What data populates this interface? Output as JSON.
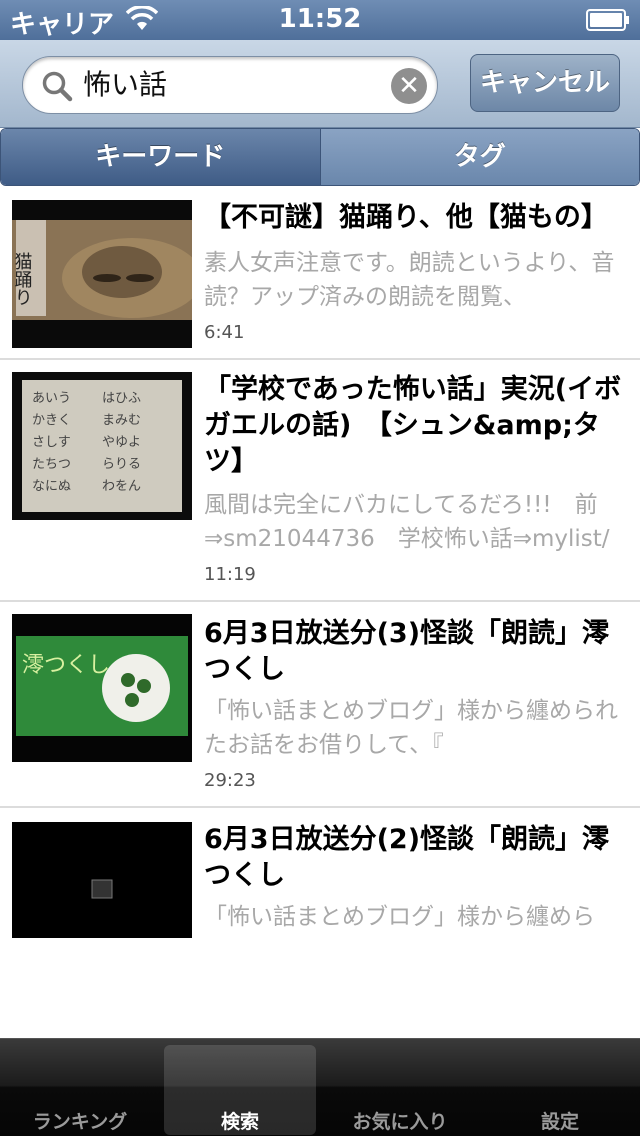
{
  "status_bar": {
    "carrier": "キャリア",
    "time": "11:52"
  },
  "search": {
    "query": "怖い話",
    "cancel_label": "キャンセル"
  },
  "segments": [
    {
      "label": "キーワード",
      "selected": true
    },
    {
      "label": "タグ",
      "selected": false
    }
  ],
  "results": [
    {
      "title": "【不可謎】猫踊り、他【猫もの】",
      "description": "素人女声注意です。朗読というより、音読？アップ済みの朗読を閲覧、",
      "duration": "6:41"
    },
    {
      "title": "「学校であった怖い話」実況(イボガエルの話)　【シュン&amp;タツ】",
      "description": "風間は完全にバカにしてるだろ!!!　前⇒sm21044736　学校怖い話⇒mylist/",
      "duration": "11:19"
    },
    {
      "title": "6月3日放送分(3)怪談「朗読」澪つくし",
      "description": "「怖い話まとめブログ」様から纏められたお話をお借りして、『",
      "duration": "29:23"
    },
    {
      "title": "6月3日放送分(2)怪談「朗読」澪つくし",
      "description": "「怖い話まとめブログ」様から纏めら",
      "duration": ""
    }
  ],
  "tab_bar": [
    {
      "label": "ランキング",
      "selected": false
    },
    {
      "label": "検索",
      "selected": true
    },
    {
      "label": "お気に入り",
      "selected": false
    },
    {
      "label": "設定",
      "selected": false
    }
  ],
  "thumbnails": {
    "thumb1_text": "猫踊り",
    "thumb3_text": "澪つくし"
  }
}
